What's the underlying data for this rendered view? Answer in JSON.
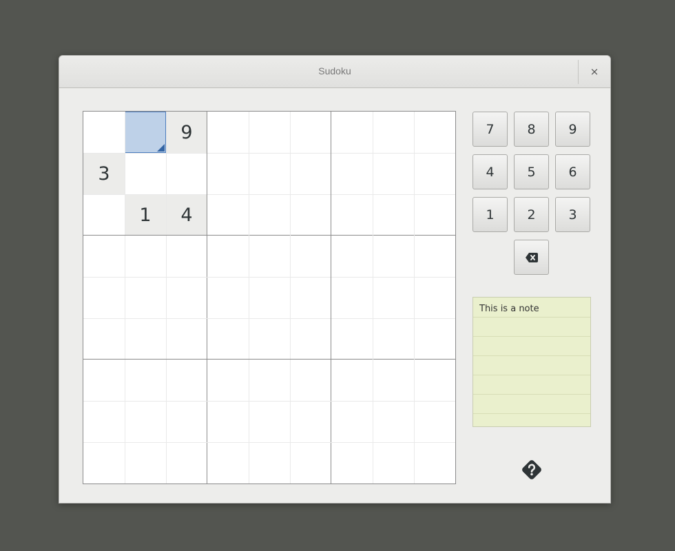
{
  "window": {
    "title": "Sudoku",
    "close_label": "×"
  },
  "board": {
    "selected_cell": {
      "row": 1,
      "col": 2
    },
    "cells": [
      {
        "row": 1,
        "col": 3,
        "value": "9",
        "given": true
      },
      {
        "row": 2,
        "col": 1,
        "value": "3",
        "given": true
      },
      {
        "row": 3,
        "col": 2,
        "value": "1",
        "given": true
      },
      {
        "row": 3,
        "col": 3,
        "value": "4",
        "given": true
      }
    ]
  },
  "keypad": {
    "numbers": [
      "7",
      "8",
      "9",
      "4",
      "5",
      "6",
      "1",
      "2",
      "3"
    ],
    "erase_icon": "backspace-icon"
  },
  "note": {
    "text": "This is a note"
  },
  "hint": {
    "icon": "question-diamond-icon"
  },
  "colors": {
    "selection": "#bed1e8",
    "selection_border": "#4a7cbf",
    "given_cell": "#ececea",
    "note_bg": "#eaf0cd"
  }
}
